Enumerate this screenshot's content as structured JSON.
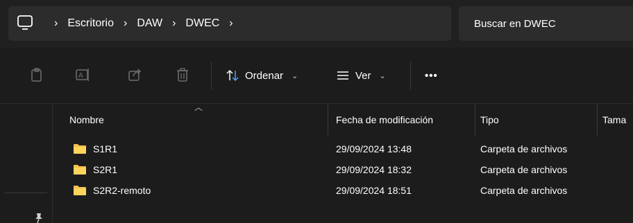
{
  "address": {
    "root_icon": "pc-icon",
    "breadcrumbs": [
      "Escritorio",
      "DAW",
      "DWEC"
    ]
  },
  "search": {
    "placeholder": "Buscar en DWEC"
  },
  "toolbar": {
    "icons": [
      "paste-icon",
      "rename-icon",
      "share-icon",
      "delete-icon"
    ],
    "sort_label": "Ordenar",
    "view_label": "Ver",
    "more_label": "•••"
  },
  "columns": {
    "name": "Nombre",
    "modified": "Fecha de modificación",
    "type": "Tipo",
    "size": "Tama"
  },
  "rows": [
    {
      "name": "S1R1",
      "modified": "29/09/2024 13:48",
      "type": "Carpeta de archivos"
    },
    {
      "name": "S2R1",
      "modified": "29/09/2024 18:32",
      "type": "Carpeta de archivos"
    },
    {
      "name": "S2R2-remoto",
      "modified": "29/09/2024 18:51",
      "type": "Carpeta de archivos"
    }
  ],
  "colors": {
    "background": "#1c1c1c",
    "folder": "#f4c04a",
    "field": "#2c2c2c"
  }
}
